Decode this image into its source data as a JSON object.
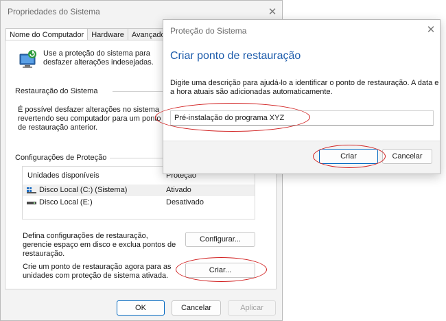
{
  "back_window": {
    "title": "Propriedades do Sistema",
    "tabs": [
      {
        "label": "Nome do Computador"
      },
      {
        "label": "Hardware"
      },
      {
        "label": "Avançado"
      }
    ],
    "intro_text": "Use a proteção do sistema para desfazer alterações indesejadas.",
    "restore_section": {
      "label": "Restauração do Sistema",
      "text": "É possível desfazer alterações no sistema revertendo seu computador para um ponto de restauração anterior."
    },
    "protection_section": {
      "label": "Configurações de Proteção",
      "columns": [
        "Unidades disponíveis",
        "Proteção"
      ],
      "rows": [
        {
          "name": "Disco Local (C:) (Sistema)",
          "status": "Ativado",
          "icon": "windows-drive-icon"
        },
        {
          "name": "Disco Local (E:)",
          "status": "Desativado",
          "icon": "drive-icon"
        }
      ]
    },
    "configure_text": "Defina configurações de restauração, gerencie espaço em disco e exclua pontos de restauração.",
    "configure_button": "Configurar...",
    "create_text": "Crie um ponto de restauração agora para as unidades com proteção de sistema ativada.",
    "create_button": "Criar...",
    "footer": {
      "ok": "OK",
      "cancel": "Cancelar",
      "apply": "Aplicar"
    }
  },
  "dialog": {
    "title": "Proteção do Sistema",
    "heading": "Criar ponto de restauração",
    "description": "Digite uma descrição para ajudá-lo a identificar o ponto de restauração. A data e a hora atuais são adicionadas automaticamente.",
    "input_value": "Pré-instalação do programa XYZ",
    "create_button": "Criar",
    "cancel_button": "Cancelar"
  },
  "colors": {
    "accent": "#0067c0",
    "heading_blue": "#1c5bab",
    "annotation_red": "#d11f1f"
  }
}
